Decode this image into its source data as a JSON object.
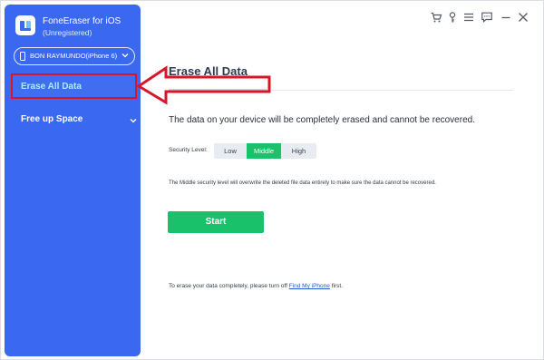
{
  "app": {
    "name": "FoneEraser for iOS",
    "status": "(Unregistered)",
    "logo_icon": "foneeraser-logo-icon",
    "accent_color": "#3a68f0"
  },
  "device": {
    "name": "BON RAYMUNDO(iPhone 6)",
    "icon": "phone-icon"
  },
  "sidebar": {
    "items": [
      {
        "label": "Erase All Data",
        "active": true
      },
      {
        "label": "Free up Space",
        "expandable": true
      }
    ]
  },
  "titlebar": {
    "icons": [
      "cart-icon",
      "key-icon",
      "menu-icon",
      "feedback-icon",
      "minimize-icon",
      "close-icon"
    ]
  },
  "main": {
    "title": "Erase All Data",
    "warning": "The data on your device will be completely erased and cannot be recovered.",
    "security": {
      "label": "Security Level:",
      "options": [
        "Low",
        "Middle",
        "High"
      ],
      "selected": "Middle",
      "selected_color": "#19c16a"
    },
    "description": "The Middle security level will overwrite the deleted file data entirely to make sure the data cannot be recovered.",
    "start_label": "Start",
    "footnote": {
      "prefix": "To erase your data completely, please turn off ",
      "link": "Find My iPhone",
      "suffix": " first."
    }
  },
  "annotation": {
    "highlight_color": "#d6172a"
  }
}
